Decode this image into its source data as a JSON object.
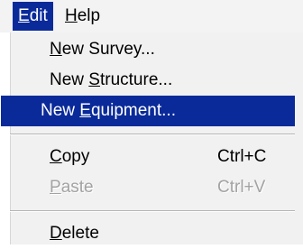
{
  "menubar": {
    "items": [
      {
        "label": "Edit",
        "mnemonic": "E",
        "rest": "dit",
        "active": true
      },
      {
        "label": "Help",
        "mnemonic": "H",
        "rest": "elp",
        "active": false
      }
    ]
  },
  "menu": {
    "items": [
      {
        "label": "New Survey...",
        "pre": "",
        "mnemonic": "N",
        "post": "ew Survey...",
        "shortcut": "",
        "state": "normal"
      },
      {
        "label": "New Structure...",
        "pre": "New ",
        "mnemonic": "S",
        "post": "tructure...",
        "shortcut": "",
        "state": "normal"
      },
      {
        "label": "New Equipment...",
        "pre": "New ",
        "mnemonic": "E",
        "post": "quipment...",
        "shortcut": "",
        "state": "highlighted"
      },
      {
        "label": "Copy",
        "pre": "",
        "mnemonic": "C",
        "post": "opy",
        "shortcut": "Ctrl+C",
        "state": "normal"
      },
      {
        "label": "Paste",
        "pre": "",
        "mnemonic": "P",
        "post": "aste",
        "shortcut": "Ctrl+V",
        "state": "disabled"
      },
      {
        "label": "Delete",
        "pre": "",
        "mnemonic": "D",
        "post": "elete",
        "shortcut": "",
        "state": "normal"
      }
    ]
  },
  "colors": {
    "highlight": "#0a2a9a",
    "menu_background": "#f1f1f1",
    "disabled_text": "#a3a3a3"
  }
}
